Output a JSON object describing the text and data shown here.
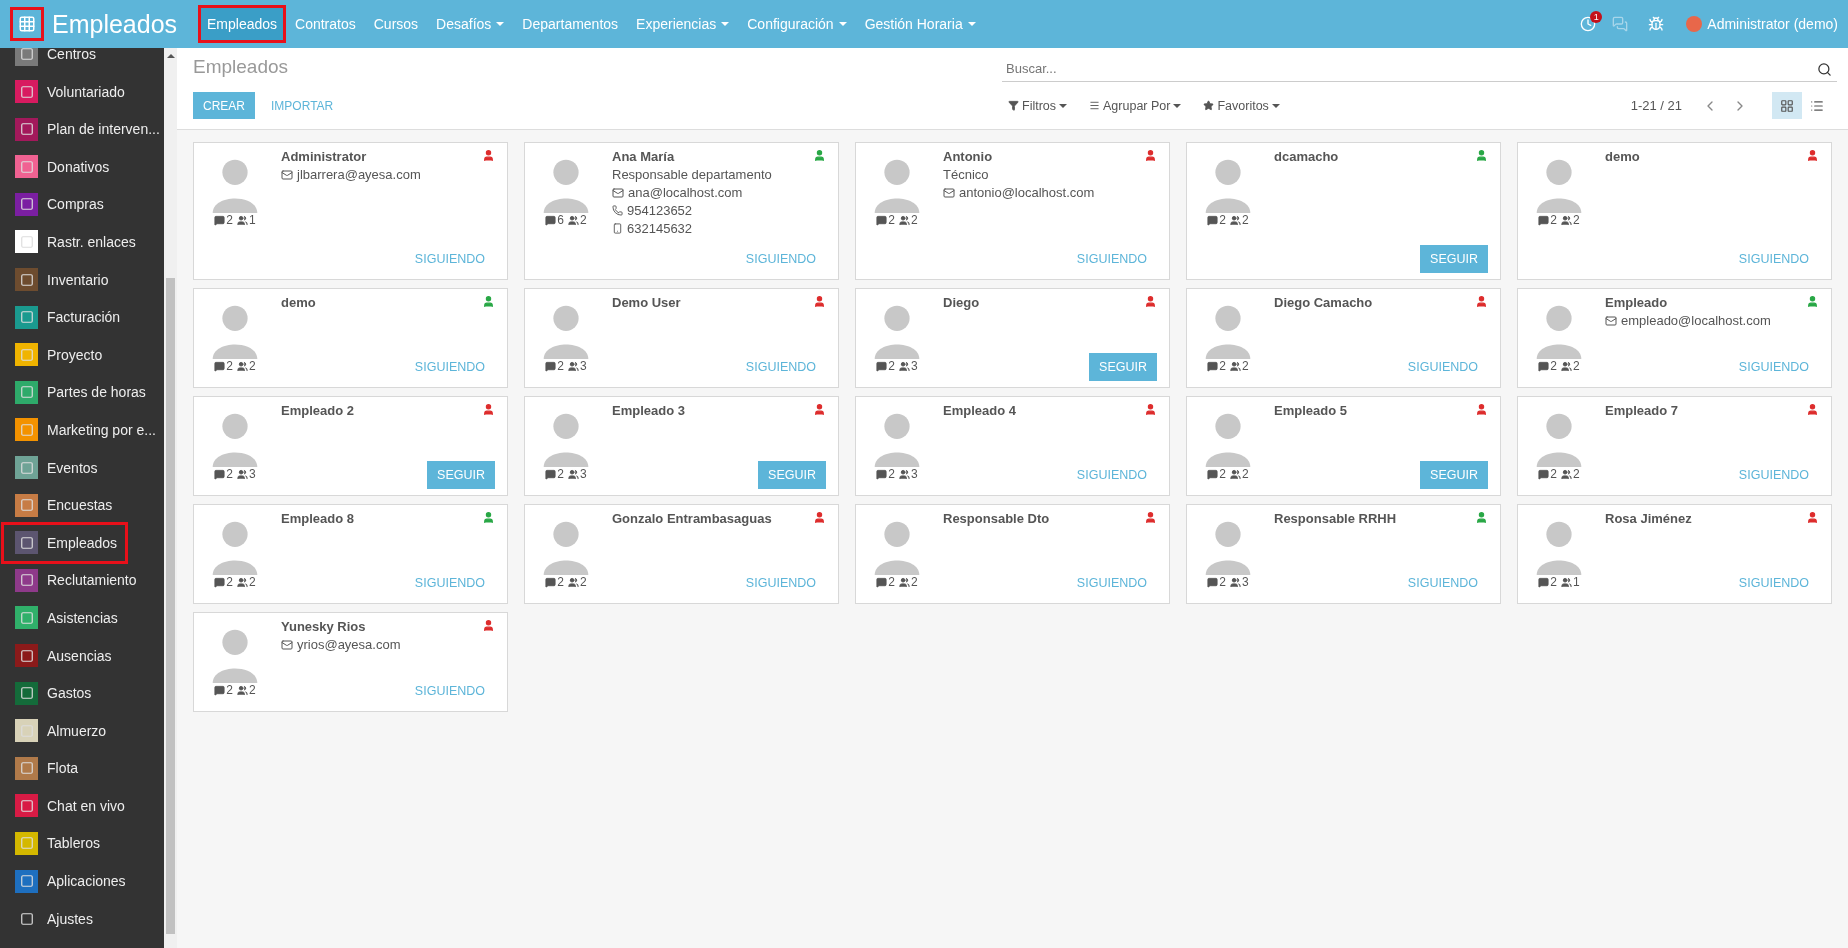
{
  "topbar": {
    "apps_button": {
      "highlighted": true
    },
    "app_title": "Empleados",
    "menu": [
      {
        "label": "Empleados",
        "dropdown": false,
        "selected": true,
        "highlighted": true
      },
      {
        "label": "Contratos",
        "dropdown": false,
        "selected": false,
        "highlighted": false
      },
      {
        "label": "Cursos",
        "dropdown": false,
        "selected": false,
        "highlighted": false
      },
      {
        "label": "Desafíos",
        "dropdown": true,
        "selected": false,
        "highlighted": false
      },
      {
        "label": "Departamentos",
        "dropdown": false,
        "selected": false,
        "highlighted": false
      },
      {
        "label": "Experiencias",
        "dropdown": true,
        "selected": false,
        "highlighted": false
      },
      {
        "label": "Configuración",
        "dropdown": true,
        "selected": false,
        "highlighted": false
      },
      {
        "label": "Gestión Horaria",
        "dropdown": true,
        "selected": false,
        "highlighted": false
      }
    ],
    "activity_badge": "1",
    "user": "Administrator (demo)"
  },
  "sidebar": {
    "items": [
      {
        "label": "Centros",
        "color": "#7a7a7a",
        "highlighted": false
      },
      {
        "label": "Voluntariado",
        "color": "#d81b60",
        "highlighted": false
      },
      {
        "label": "Plan de interven...",
        "color": "#a3195b",
        "highlighted": false
      },
      {
        "label": "Donativos",
        "color": "#f06292",
        "highlighted": false
      },
      {
        "label": "Compras",
        "color": "#7b1fa2",
        "highlighted": false
      },
      {
        "label": "Rastr. enlaces",
        "color": "#ffffff",
        "highlighted": false
      },
      {
        "label": "Inventario",
        "color": "#6d4c2f",
        "highlighted": false
      },
      {
        "label": "Facturación",
        "color": "#1a9a8f",
        "highlighted": false
      },
      {
        "label": "Proyecto",
        "color": "#f0b400",
        "highlighted": false
      },
      {
        "label": "Partes de horas",
        "color": "#2eaa6a",
        "highlighted": false
      },
      {
        "label": "Marketing por e...",
        "color": "#f39200",
        "highlighted": false
      },
      {
        "label": "Eventos",
        "color": "#6fa396",
        "highlighted": false
      },
      {
        "label": "Encuestas",
        "color": "#c77c45",
        "highlighted": false
      },
      {
        "label": "Empleados",
        "color": "#5c5570",
        "highlighted": true
      },
      {
        "label": "Reclutamiento",
        "color": "#8e3a8a",
        "highlighted": false
      },
      {
        "label": "Asistencias",
        "color": "#30b06a",
        "highlighted": false
      },
      {
        "label": "Ausencias",
        "color": "#8b1a1a",
        "highlighted": false
      },
      {
        "label": "Gastos",
        "color": "#146b3a",
        "highlighted": false
      },
      {
        "label": "Almuerzo",
        "color": "#d8d2b8",
        "highlighted": false
      },
      {
        "label": "Flota",
        "color": "#b07a4a",
        "highlighted": false
      },
      {
        "label": "Chat en vivo",
        "color": "#d81b45",
        "highlighted": false
      },
      {
        "label": "Tableros",
        "color": "#d4b800",
        "highlighted": false
      },
      {
        "label": "Aplicaciones",
        "color": "#1e6fbf",
        "highlighted": false
      },
      {
        "label": "Ajustes",
        "color": "#333333",
        "highlighted": false
      }
    ]
  },
  "control_panel": {
    "title": "Empleados",
    "buttons": [
      "CREAR",
      "IMPORTAR"
    ],
    "search": {
      "placeholder": "Buscar..."
    },
    "filters": [
      "Filtros",
      "Agrupar Por",
      "Favoritos"
    ],
    "pager": "1-21 / 21",
    "views": [
      {
        "kind": "kanban",
        "selected": true
      },
      {
        "kind": "list",
        "selected": false
      }
    ]
  },
  "employees": [
    {
      "name": "Administrator",
      "email": "jlbarrera@ayesa.com",
      "messages": "2",
      "followers": "1",
      "online": false,
      "following": true,
      "action": "SIGUIENDO"
    },
    {
      "name": "Ana María",
      "job": "Responsable departamento",
      "email": "ana@localhost.com",
      "phone": "954123652",
      "mobile": "632145632",
      "messages": "6",
      "followers": "2",
      "online": true,
      "following": true,
      "action": "SIGUIENDO"
    },
    {
      "name": "Antonio",
      "job": "Técnico",
      "email": "antonio@localhost.com",
      "messages": "2",
      "followers": "2",
      "online": false,
      "following": true,
      "action": "SIGUIENDO"
    },
    {
      "name": "dcamacho",
      "messages": "2",
      "followers": "2",
      "online": true,
      "following": false,
      "action": "SEGUIR"
    },
    {
      "name": "demo",
      "messages": "2",
      "followers": "2",
      "online": false,
      "following": true,
      "action": "SIGUIENDO"
    },
    {
      "name": "demo",
      "messages": "2",
      "followers": "2",
      "online": true,
      "following": true,
      "action": "SIGUIENDO"
    },
    {
      "name": "Demo User",
      "messages": "2",
      "followers": "3",
      "online": false,
      "following": true,
      "action": "SIGUIENDO"
    },
    {
      "name": "Diego",
      "messages": "2",
      "followers": "3",
      "online": false,
      "following": false,
      "action": "SEGUIR"
    },
    {
      "name": "Diego Camacho",
      "messages": "2",
      "followers": "2",
      "online": false,
      "following": true,
      "action": "SIGUIENDO"
    },
    {
      "name": "Empleado",
      "email": "empleado@localhost.com",
      "messages": "2",
      "followers": "2",
      "online": true,
      "following": true,
      "action": "SIGUIENDO"
    },
    {
      "name": "Empleado 2",
      "messages": "2",
      "followers": "3",
      "online": false,
      "following": false,
      "action": "SEGUIR"
    },
    {
      "name": "Empleado 3",
      "messages": "2",
      "followers": "3",
      "online": false,
      "following": false,
      "action": "SEGUIR"
    },
    {
      "name": "Empleado 4",
      "messages": "2",
      "followers": "3",
      "online": false,
      "following": true,
      "action": "SIGUIENDO"
    },
    {
      "name": "Empleado 5",
      "messages": "2",
      "followers": "2",
      "online": false,
      "following": false,
      "action": "SEGUIR"
    },
    {
      "name": "Empleado 7",
      "messages": "2",
      "followers": "2",
      "online": false,
      "following": true,
      "action": "SIGUIENDO"
    },
    {
      "name": "Empleado 8",
      "messages": "2",
      "followers": "2",
      "online": true,
      "following": true,
      "action": "SIGUIENDO"
    },
    {
      "name": "Gonzalo Entrambasaguas",
      "messages": "2",
      "followers": "2",
      "online": false,
      "following": true,
      "action": "SIGUIENDO"
    },
    {
      "name": "Responsable Dto",
      "messages": "2",
      "followers": "2",
      "online": false,
      "following": true,
      "action": "SIGUIENDO"
    },
    {
      "name": "Responsable RRHH",
      "messages": "2",
      "followers": "3",
      "online": true,
      "following": true,
      "action": "SIGUIENDO"
    },
    {
      "name": "Rosa Jiménez",
      "messages": "2",
      "followers": "1",
      "online": false,
      "following": true,
      "action": "SIGUIENDO"
    },
    {
      "name": "Yunesky Rios",
      "email": "yrios@ayesa.com",
      "messages": "2",
      "followers": "2",
      "online": false,
      "following": true,
      "action": "SIGUIENDO"
    }
  ]
}
